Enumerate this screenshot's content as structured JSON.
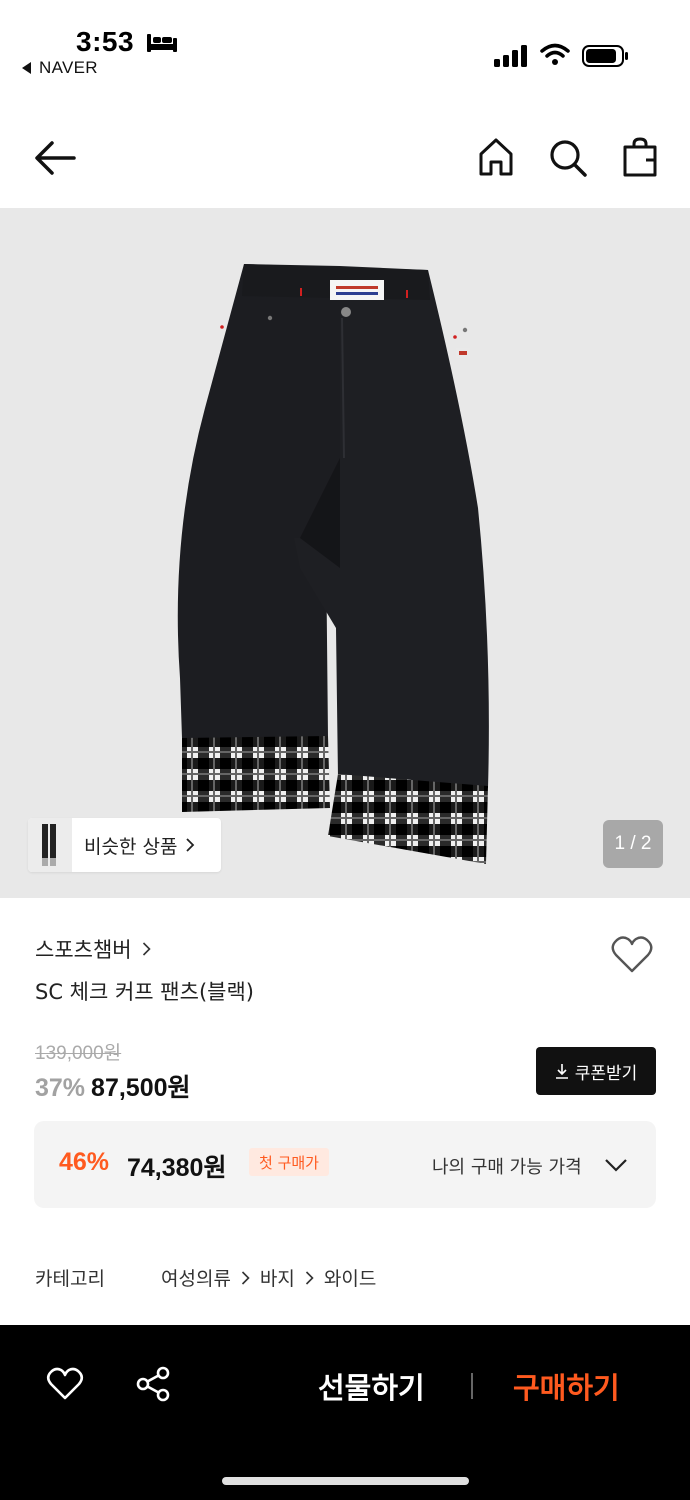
{
  "status_bar": {
    "time": "3:53",
    "back_app": "NAVER",
    "icons": [
      "sleep-icon",
      "signal-icon",
      "wifi-icon",
      "battery-icon"
    ]
  },
  "nav": {
    "icons": [
      "back-arrow-icon",
      "home-icon",
      "search-icon",
      "shopping-bag-icon"
    ]
  },
  "gallery": {
    "similar_label": "비슷한 상품",
    "page_indicator": "1 / 2",
    "image_subject": "black wide pants with plaid cuffs"
  },
  "product": {
    "brand": "스포츠챔버",
    "name": "SC 체크 커프 팬츠(블랙)",
    "original_price": "139,000원",
    "discount_rate": "37%",
    "sale_price": "87,500원",
    "coupon_label": "쿠폰받기"
  },
  "benefit": {
    "rate": "46%",
    "price": "74,380원",
    "badge": "첫 구매가",
    "my_price_label": "나의 구매 가능 가격"
  },
  "category": {
    "label": "카테고리",
    "path": [
      "여성의류",
      "바지",
      "와이드"
    ]
  },
  "bottom_bar": {
    "gift_label": "선물하기",
    "buy_label": "구매하기"
  },
  "colors": {
    "accent": "#ff5a1f",
    "dark": "#111111",
    "image_bg": "#e8e8e8",
    "benefit_bg": "#f4f4f4"
  }
}
